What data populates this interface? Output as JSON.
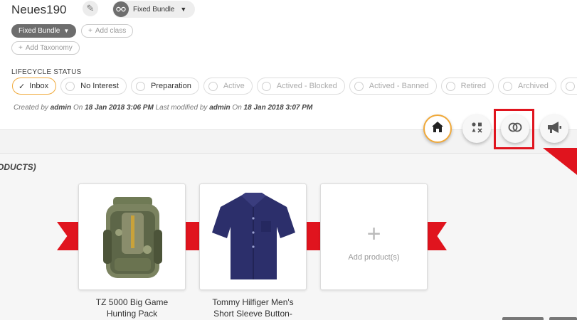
{
  "header": {
    "title": "Neues190",
    "edit_icon": "pencil-icon",
    "type_dropdown": {
      "label": "Fixed Bundle",
      "icon": "bundle-glasses-icon"
    }
  },
  "tags": {
    "class_pill": "Fixed Bundle",
    "add_class": "Add class",
    "add_taxonomy": "Add Taxonomy"
  },
  "lifecycle": {
    "label": "LIFECYCLE STATUS",
    "statuses": [
      "Inbox",
      "No Interest",
      "Preparation",
      "Active",
      "Actived - Blocked",
      "Actived - Banned",
      "Retired",
      "Archived"
    ],
    "selected": "Inbox"
  },
  "meta": {
    "created_prefix": "Created by",
    "created_user": "admin",
    "created_on_label": "On",
    "created_date": "18 Jan 2018 3:06 PM",
    "modified_prefix": "Last modified by",
    "modified_user": "admin",
    "modified_on_label": "On",
    "modified_date": "18 Jan 2018 3:07 PM"
  },
  "toolbar": {
    "buttons": [
      "home-icon",
      "apps-icon",
      "bundle-link-icon",
      "megaphone-icon"
    ],
    "accent": "#f0a93a",
    "highlight": "#e0141e"
  },
  "section": {
    "title": "ODUCTS)"
  },
  "products": [
    {
      "name_line1": "TZ 5000 Big Game",
      "name_line2": "Hunting Pack"
    },
    {
      "name_line1": "Tommy Hilfiger Men's",
      "name_line2": "Short Sleeve Button-"
    }
  ],
  "add_product": {
    "label": "Add product(s)"
  }
}
